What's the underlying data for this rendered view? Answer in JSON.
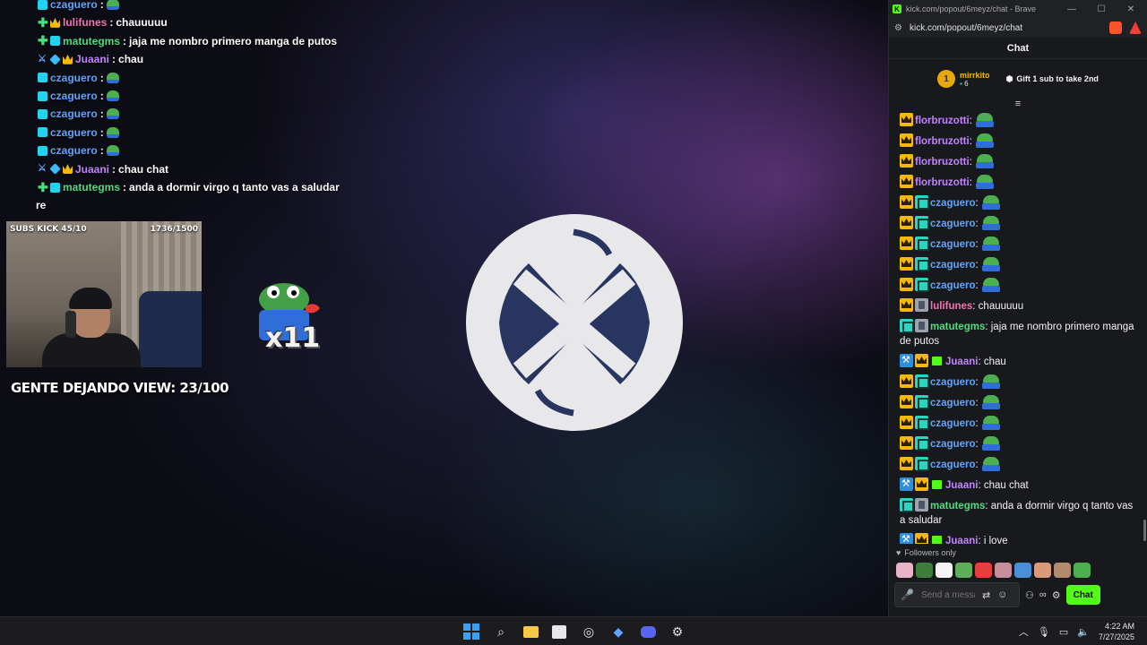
{
  "overlay_chat": [
    {
      "badges": [
        "sub"
      ],
      "user": "czaguero",
      "color": "#60a5fa",
      "msg": "",
      "emote": true
    },
    {
      "badges": [
        "plus",
        "crown"
      ],
      "user": "lulifunes",
      "color": "#f472b6",
      "msg": "chauuuuu",
      "emote": false
    },
    {
      "badges": [
        "plus",
        "sub"
      ],
      "user": "matutegms",
      "color": "#4ade80",
      "msg": "jaja me nombro primero manga de putos",
      "emote": false
    },
    {
      "badges": [
        "sword",
        "cube",
        "crown"
      ],
      "user": "Juaani",
      "color": "#c084fc",
      "msg": "chau",
      "emote": false
    },
    {
      "badges": [
        "sub"
      ],
      "user": "czaguero",
      "color": "#60a5fa",
      "msg": "",
      "emote": true
    },
    {
      "badges": [
        "sub"
      ],
      "user": "czaguero",
      "color": "#60a5fa",
      "msg": "",
      "emote": true
    },
    {
      "badges": [
        "sub"
      ],
      "user": "czaguero",
      "color": "#60a5fa",
      "msg": "",
      "emote": true
    },
    {
      "badges": [
        "sub"
      ],
      "user": "czaguero",
      "color": "#60a5fa",
      "msg": "",
      "emote": true
    },
    {
      "badges": [
        "sub"
      ],
      "user": "czaguero",
      "color": "#60a5fa",
      "msg": "",
      "emote": true
    },
    {
      "badges": [
        "sword",
        "cube",
        "crown"
      ],
      "user": "Juaani",
      "color": "#c084fc",
      "msg": "chau chat",
      "emote": false
    },
    {
      "badges": [
        "plus",
        "sub"
      ],
      "user": "matutegms",
      "color": "#4ade80",
      "msg": "anda a dormir virgo q tanto vas a saludar",
      "emote": false
    }
  ],
  "overlay_partial": "re",
  "webcam": {
    "subs_label": "SUBS KICK 45/10",
    "goal_label": "1736/1500"
  },
  "gente_dejando": "GENTE DEJANDO VIEW: 23/100",
  "alert_multiplier": "x11",
  "browser": {
    "title": "kick.com/popout/6meyz/chat - Brave",
    "url": "kick.com/popout/6meyz/chat",
    "window_controls": [
      "—",
      "☐",
      "✕"
    ]
  },
  "chat": {
    "header": "Chat",
    "pinned_user": "mirrkito",
    "pinned_rank": "1",
    "pinned_count": "6",
    "gift_label": "Gift 1 sub to take 2nd",
    "messages": [
      {
        "badges": [
          "crown"
        ],
        "user": "florbruzotti",
        "color": "#c084fc",
        "text": "",
        "emote": true
      },
      {
        "badges": [
          "crown"
        ],
        "user": "florbruzotti",
        "color": "#c084fc",
        "text": "",
        "emote": true
      },
      {
        "badges": [
          "crown"
        ],
        "user": "florbruzotti",
        "color": "#c084fc",
        "text": "",
        "emote": true
      },
      {
        "badges": [
          "crown"
        ],
        "user": "florbruzotti",
        "color": "#c084fc",
        "text": "",
        "emote": true
      },
      {
        "badges": [
          "crown",
          "sub"
        ],
        "user": "czaguero",
        "color": "#60a5fa",
        "text": "",
        "emote": true
      },
      {
        "badges": [
          "crown",
          "sub"
        ],
        "user": "czaguero",
        "color": "#60a5fa",
        "text": "",
        "emote": true
      },
      {
        "badges": [
          "crown",
          "sub"
        ],
        "user": "czaguero",
        "color": "#60a5fa",
        "text": "",
        "emote": true
      },
      {
        "badges": [
          "crown",
          "sub"
        ],
        "user": "czaguero",
        "color": "#60a5fa",
        "text": "",
        "emote": true
      },
      {
        "badges": [
          "crown",
          "sub"
        ],
        "user": "czaguero",
        "color": "#60a5fa",
        "text": "",
        "emote": true
      },
      {
        "badges": [
          "crown",
          "silver"
        ],
        "user": "lulifunes",
        "color": "#f472b6",
        "text": "chauuuuu",
        "emote": false
      },
      {
        "badges": [
          "sub",
          "silver"
        ],
        "user": "matutegms",
        "color": "#4ade80",
        "text": "jaja me nombro primero manga de putos",
        "emote": false
      },
      {
        "badges": [
          "mod",
          "crown",
          "gift"
        ],
        "user": "Juaani",
        "color": "#c084fc",
        "text": "chau",
        "emote": false
      },
      {
        "badges": [
          "crown",
          "sub"
        ],
        "user": "czaguero",
        "color": "#60a5fa",
        "text": "",
        "emote": true
      },
      {
        "badges": [
          "crown",
          "sub"
        ],
        "user": "czaguero",
        "color": "#60a5fa",
        "text": "",
        "emote": true
      },
      {
        "badges": [
          "crown",
          "sub"
        ],
        "user": "czaguero",
        "color": "#60a5fa",
        "text": "",
        "emote": true
      },
      {
        "badges": [
          "crown",
          "sub"
        ],
        "user": "czaguero",
        "color": "#60a5fa",
        "text": "",
        "emote": true
      },
      {
        "badges": [
          "crown",
          "sub"
        ],
        "user": "czaguero",
        "color": "#60a5fa",
        "text": "",
        "emote": true
      },
      {
        "badges": [
          "mod",
          "crown",
          "gift"
        ],
        "user": "Juaani",
        "color": "#c084fc",
        "text": "chau chat",
        "emote": false
      },
      {
        "badges": [
          "sub",
          "silver"
        ],
        "user": "matutegms",
        "color": "#4ade80",
        "text": "anda a dormir virgo q tanto vas a saludar",
        "emote": false
      },
      {
        "badges": [
          "mod",
          "crown",
          "gift"
        ],
        "user": "Juaani",
        "color": "#c084fc",
        "text": "i love",
        "emote": false
      }
    ],
    "followers_only": "Followers only",
    "emote_colors": [
      "#e8b4c8",
      "#3f7d3a",
      "#f4f4f4",
      "#5fae5a",
      "#e53e3e",
      "#c98e9c",
      "#4a90d9",
      "#d99a7a",
      "#b38b6d",
      "#4caf50"
    ],
    "input_placeholder": "Send a message",
    "send_label": "Chat"
  },
  "taskbar": {
    "time": "4:22 AM",
    "date": "7/27/2025"
  }
}
